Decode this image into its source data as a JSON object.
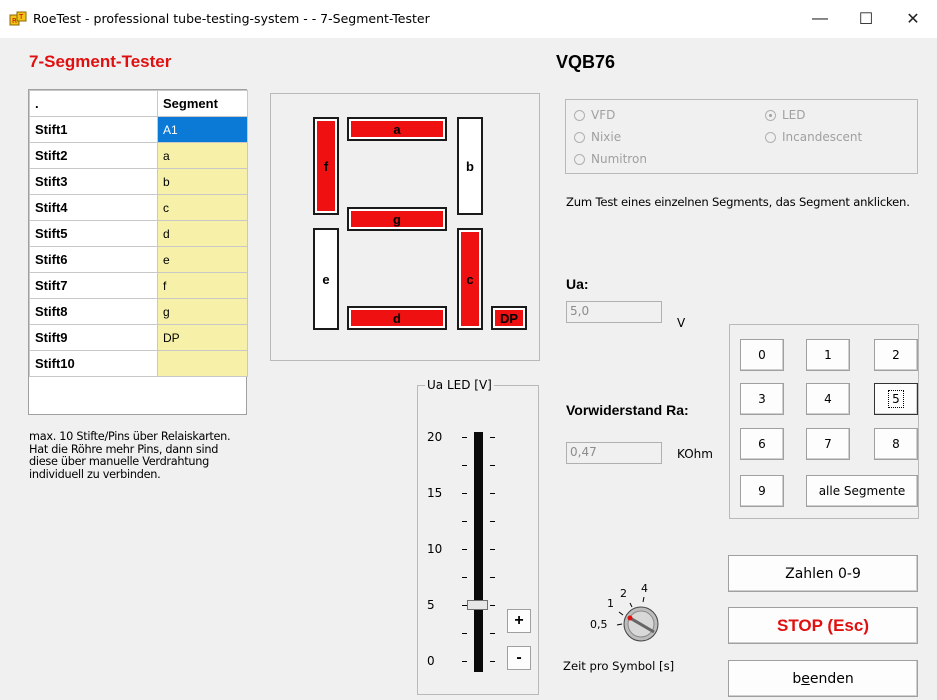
{
  "window": {
    "title": "RoeTest - professional tube-testing-system -  - 7-Segment-Tester",
    "minimize": "—",
    "maximize": "☐",
    "close": "✕"
  },
  "heading": "7-Segment-Tester",
  "tube_name": "VQB76",
  "pin_table": {
    "header": [
      ".",
      "Segment"
    ],
    "rows": [
      {
        "pin": "Stift1",
        "segment": "A1"
      },
      {
        "pin": "Stift2",
        "segment": "a"
      },
      {
        "pin": "Stift3",
        "segment": "b"
      },
      {
        "pin": "Stift4",
        "segment": "c"
      },
      {
        "pin": "Stift5",
        "segment": "d"
      },
      {
        "pin": "Stift6",
        "segment": "e"
      },
      {
        "pin": "Stift7",
        "segment": "f"
      },
      {
        "pin": "Stift8",
        "segment": "g"
      },
      {
        "pin": "Stift9",
        "segment": "DP"
      },
      {
        "pin": "Stift10",
        "segment": ""
      }
    ]
  },
  "note": {
    "line1": "max. 10 Stifte/Pins über Relaiskarten.",
    "line2": "Hat die Röhre mehr Pins, dann sind",
    "line3": "diese über manuelle Verdrahtung",
    "line4": "individuell zu verbinden."
  },
  "segments": {
    "a": {
      "label": "a",
      "lit": true
    },
    "b": {
      "label": "b",
      "lit": false
    },
    "c": {
      "label": "c",
      "lit": true
    },
    "d": {
      "label": "d",
      "lit": true
    },
    "e": {
      "label": "e",
      "lit": false
    },
    "f": {
      "label": "f",
      "lit": true
    },
    "g": {
      "label": "g",
      "lit": true
    },
    "dp": {
      "label": "DP",
      "lit": true
    }
  },
  "display_type": {
    "vfd": "VFD",
    "nixie": "Nixie",
    "numitron": "Numitron",
    "led": "LED",
    "incandescent": "Incandescent",
    "selected": "LED"
  },
  "hint": "Zum Test eines einzelnen Segments, das Segment anklicken.",
  "ua": {
    "label": "Ua:",
    "value": "5,0",
    "unit": "V"
  },
  "resistor": {
    "label": "Vorwiderstand Ra:",
    "value": "0,47",
    "unit": "KOhm"
  },
  "slider": {
    "title": "Ua LED [V]",
    "ticks": [
      "20",
      "15",
      "10",
      "5",
      "0"
    ],
    "value": 5,
    "min": 0,
    "max": 20,
    "plus": "+",
    "minus": "-"
  },
  "digit_buttons": {
    "b0": "0",
    "b1": "1",
    "b2": "2",
    "b3": "3",
    "b4": "4",
    "b5": "5",
    "b6": "6",
    "b7": "7",
    "b8": "8",
    "b9": "9",
    "all": "alle Segmente",
    "focused": "5"
  },
  "knob": {
    "labels": [
      "0,5",
      "1",
      "2",
      "4"
    ],
    "caption": "Zeit pro Symbol [s]",
    "value": "0,5"
  },
  "buttons": {
    "zahlen": "Zahlen 0-9",
    "stop": "STOP (Esc)",
    "beenden_pre": "b",
    "beenden_mid": "e",
    "beenden_post": "enden"
  }
}
